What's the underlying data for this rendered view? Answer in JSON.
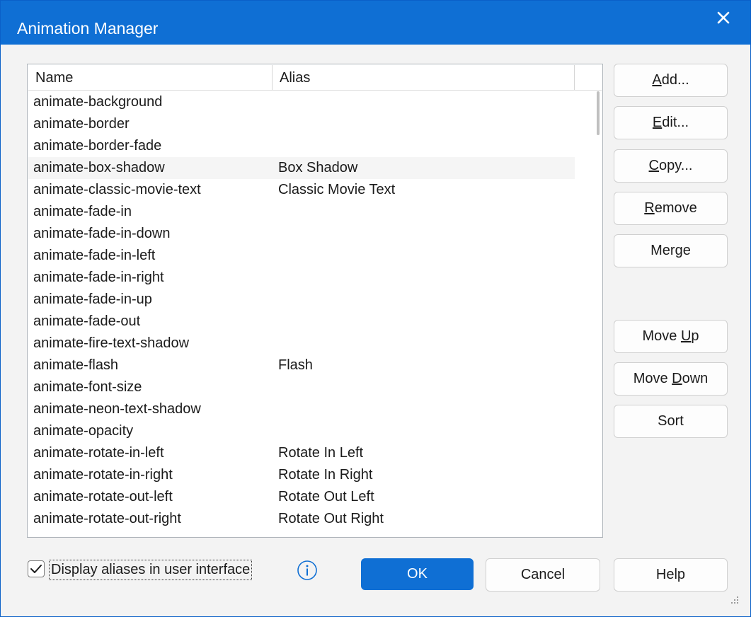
{
  "window": {
    "title": "Animation Manager"
  },
  "list": {
    "columns": {
      "name": "Name",
      "alias": "Alias"
    },
    "selected_index": 3,
    "rows": [
      {
        "name": "animate-background",
        "alias": ""
      },
      {
        "name": "animate-border",
        "alias": ""
      },
      {
        "name": "animate-border-fade",
        "alias": ""
      },
      {
        "name": "animate-box-shadow",
        "alias": "Box Shadow"
      },
      {
        "name": "animate-classic-movie-text",
        "alias": "Classic Movie Text"
      },
      {
        "name": "animate-fade-in",
        "alias": ""
      },
      {
        "name": "animate-fade-in-down",
        "alias": ""
      },
      {
        "name": "animate-fade-in-left",
        "alias": ""
      },
      {
        "name": "animate-fade-in-right",
        "alias": ""
      },
      {
        "name": "animate-fade-in-up",
        "alias": ""
      },
      {
        "name": "animate-fade-out",
        "alias": ""
      },
      {
        "name": "animate-fire-text-shadow",
        "alias": ""
      },
      {
        "name": "animate-flash",
        "alias": "Flash"
      },
      {
        "name": "animate-font-size",
        "alias": ""
      },
      {
        "name": "animate-neon-text-shadow",
        "alias": ""
      },
      {
        "name": "animate-opacity",
        "alias": ""
      },
      {
        "name": "animate-rotate-in-left",
        "alias": "Rotate In Left"
      },
      {
        "name": "animate-rotate-in-right",
        "alias": "Rotate In Right"
      },
      {
        "name": "animate-rotate-out-left",
        "alias": "Rotate Out Left"
      },
      {
        "name": "animate-rotate-out-right",
        "alias": "Rotate Out Right"
      }
    ]
  },
  "buttons": {
    "add": {
      "before": "",
      "key": "A",
      "after": "dd..."
    },
    "edit": {
      "before": "",
      "key": "E",
      "after": "dit..."
    },
    "copy": {
      "before": "",
      "key": "C",
      "after": "opy..."
    },
    "remove": {
      "before": "",
      "key": "R",
      "after": "emove"
    },
    "merge": {
      "label": "Merge"
    },
    "move_up": {
      "before": "Move ",
      "key": "U",
      "after": "p"
    },
    "move_down": {
      "before": "Move ",
      "key": "D",
      "after": "own"
    },
    "sort": {
      "label": "Sort"
    },
    "ok": "OK",
    "cancel": "Cancel",
    "help": "Help"
  },
  "options": {
    "display_aliases_label": "Display aliases in user interface",
    "display_aliases_checked": true
  },
  "colors": {
    "accent": "#0f6fd4",
    "background": "#f3f3f3",
    "selected_row": "#f5f5f5"
  }
}
